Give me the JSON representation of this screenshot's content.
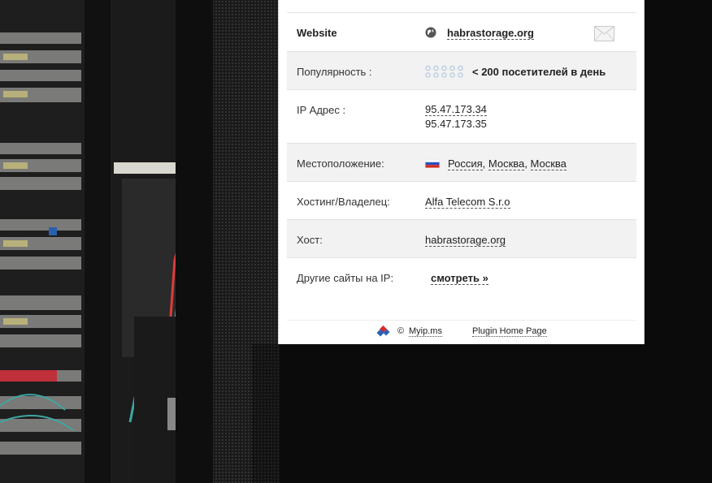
{
  "rows": {
    "website": {
      "label": "Website",
      "value": "habrastorage.org"
    },
    "popularity": {
      "label": "Популярность :",
      "value": "< 200 посетителей в день",
      "rating": 0,
      "rating_max": 5
    },
    "ip": {
      "label": "IP Адрес :",
      "ip1": "95.47.173.34",
      "ip2": "95.47.173.35"
    },
    "location": {
      "label": "Местоположение:",
      "country": "Россия",
      "sep1": ",",
      "region": "Москва",
      "sep2": ",",
      "city": "Москва"
    },
    "hosting": {
      "label": "Хостинг/Владелец:",
      "value": "Alfa Telecom S.r.o"
    },
    "host": {
      "label": "Хост:",
      "value": "habrastorage.org"
    },
    "other_sites": {
      "label": "Другие сайты на IP:",
      "value": "смотреть »"
    }
  },
  "footer": {
    "copyright": "©",
    "myip": "Myip.ms",
    "plugin": "Plugin Home Page"
  },
  "icons": {
    "globe": "globe-icon",
    "mail": "mail-icon",
    "rating": "rating-dots-icon",
    "flag": "russia-flag-icon",
    "logo": "myip-logo-icon"
  },
  "colors": {
    "panel_bg": "#ffffff",
    "alt_row": "#f2f2f2",
    "rating_dots": "#a9c3e0"
  }
}
